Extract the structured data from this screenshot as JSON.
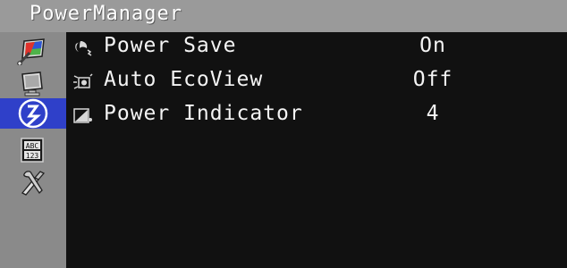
{
  "window": {
    "title": "PowerManager"
  },
  "sidebar": {
    "items": [
      {
        "icon": "color-adjust-icon",
        "selected": false
      },
      {
        "icon": "screen-monitor-icon",
        "selected": false
      },
      {
        "icon": "power-manager-icon",
        "selected": true
      },
      {
        "icon": "language-abc-123-icon",
        "selected": false
      },
      {
        "icon": "tools-settings-icon",
        "selected": false
      }
    ],
    "highlight_color": "#2f40c9",
    "icon_text": "ABC\n123"
  },
  "menu": {
    "rows": [
      {
        "icon": "power-save-icon",
        "label": "Power Save",
        "value": "On"
      },
      {
        "icon": "auto-ecoview-icon",
        "label": "Auto EcoView",
        "value": "Off"
      },
      {
        "icon": "power-indicator-icon",
        "label": "Power Indicator",
        "value": "4"
      }
    ]
  },
  "colors": {
    "background": "#111111",
    "text": "#f4f4f4",
    "frame": "#8c8c8c"
  }
}
